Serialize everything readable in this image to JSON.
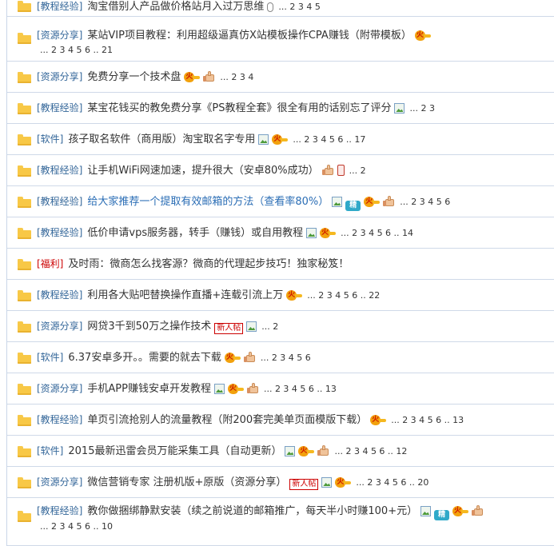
{
  "threads": [
    {
      "category": "[教程经验]",
      "title": "淘宝借别人产品做价格站月入过万思维",
      "pages": "... 2 3 4 5"
    },
    {
      "category": "[资源分享]",
      "title": "某站VIP项目教程：利用超级逼真仿X站模板操作CPA赚钱（附带模板）",
      "pages": "... 2 3 4 5 6 .. 21"
    },
    {
      "category": "[资源分享]",
      "title": "免费分享一个技术盘",
      "pages": "... 2 3 4"
    },
    {
      "category": "[教程经验]",
      "title": "某宝花钱买的教免费分享《PS教程全套》很全有用的话别忘了评分",
      "pages": "... 2 3"
    },
    {
      "category": "[软件]",
      "title": "孩子取名软件（商用版）淘宝取名字专用",
      "pages": "... 2 3 4 5 6 .. 17"
    },
    {
      "category": "[教程经验]",
      "title": "让手机WiFi网速加速，提升很大（安卓80%成功）",
      "pages": "... 2"
    },
    {
      "category": "[教程经验]",
      "title": "给大家推荐一个提取有效邮箱的方法（查看率80%）",
      "pages": "... 2 3 4 5 6",
      "jing": "精"
    },
    {
      "category": "[教程经验]",
      "title": "低价申请vps服务器，转手（赚钱）或自用教程",
      "pages": "... 2 3 4 5 6 .. 14"
    },
    {
      "category": "[福利]",
      "title": "及时雨：微商怎么找客源？微商的代理起步技巧！独家秘笈！",
      "pages": ""
    },
    {
      "category": "[教程经验]",
      "title": "利用各大贴吧替换操作直播+连载引流上万",
      "pages": "... 2 3 4 5 6 .. 22"
    },
    {
      "category": "[资源分享]",
      "title": "网贷3千到50万之操作技术",
      "pages": "... 2",
      "badge": "新人帖"
    },
    {
      "category": "[软件]",
      "title": "6.37安卓多开。。需要的就去下载",
      "pages": "... 2 3 4 5 6"
    },
    {
      "category": "[资源分享]",
      "title": "手机APP赚钱安卓开发教程",
      "pages": "... 2 3 4 5 6 .. 13"
    },
    {
      "category": "[教程经验]",
      "title": "单页引流抢别人的流量教程（附200套完美单页面模版下载）",
      "pages": "... 2 3 4 5 6 .. 13"
    },
    {
      "category": "[软件]",
      "title": "2015最新迅雷会员万能采集工具（自动更新）",
      "pages": "... 2 3 4 5 6 .. 12"
    },
    {
      "category": "[资源分享]",
      "title": "微信营销专家 注册机版+原版（资源分享）",
      "pages": "... 2 3 4 5 6 .. 20",
      "badge": "新人帖"
    },
    {
      "category": "[教程经验]",
      "title": "教你做捆绑静默安装（续之前说道的邮箱推广，每天半小时赚100+元）",
      "pages": "... 2 3 4 5 6 .. 10",
      "jing": "精"
    }
  ],
  "icons": {
    "hot": "fire-hot-icon",
    "thumb": "thumbs-up-icon",
    "image": "image-attachment-icon",
    "phone": "mobile-phone-icon",
    "attach": "paperclip-icon"
  },
  "colors": {
    "category": "#336699",
    "welfare": "#cc0000",
    "highlight_title": "#2a6db5",
    "folder": "#f8c846"
  }
}
